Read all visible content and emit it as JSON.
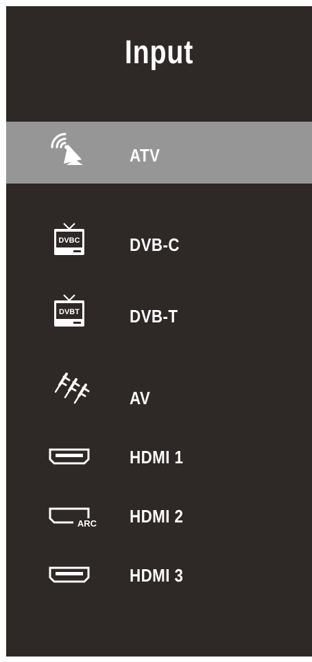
{
  "menu": {
    "title": "Input",
    "selected_index": 0,
    "items": [
      {
        "label": "ATV",
        "icon": "satellite-dish-icon"
      },
      {
        "label": "DVB-C",
        "icon": "tv-dvbc-icon",
        "icon_text": "DVBC"
      },
      {
        "label": "DVB-T",
        "icon": "tv-dvbt-icon",
        "icon_text": "DVBT"
      },
      {
        "label": "AV",
        "icon": "av-rca-cable-icon"
      },
      {
        "label": "HDMI 1",
        "icon": "hdmi-port-icon"
      },
      {
        "label": "HDMI 2",
        "icon": "hdmi-arc-port-icon",
        "icon_text": "ARC"
      },
      {
        "label": "HDMI 3",
        "icon": "hdmi-port-icon"
      }
    ]
  },
  "colors": {
    "panel_background": "#2e2826",
    "selected_background": "#969696",
    "text": "#ffffff"
  }
}
